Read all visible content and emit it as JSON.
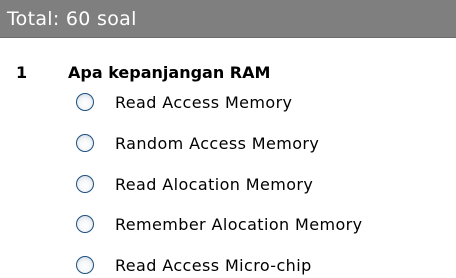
{
  "header": {
    "title": "Total: 60 soal"
  },
  "question": {
    "number": "1",
    "text": "Apa kepanjangan RAM",
    "options": [
      {
        "label": "Read Access Memory"
      },
      {
        "label": "Random Access Memory"
      },
      {
        "label": "Read Alocation Memory"
      },
      {
        "label": "Remember Alocation Memory"
      },
      {
        "label": "Read Access Micro-chip"
      }
    ]
  },
  "colors": {
    "header_bg": "#7f7f7f",
    "header_text": "#ffffff",
    "radio_border": "#1c5180"
  }
}
